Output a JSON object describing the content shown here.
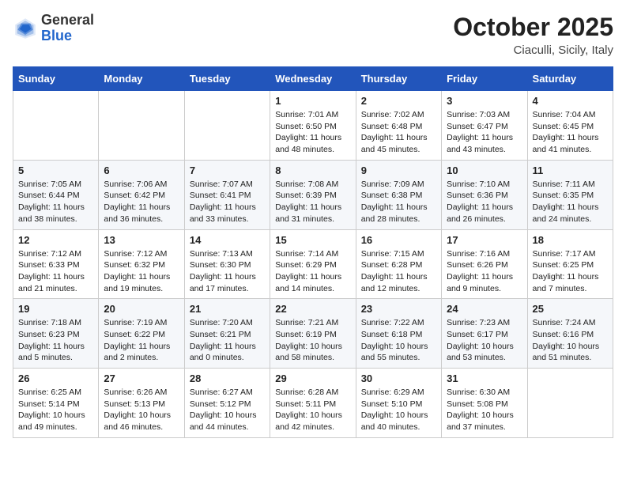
{
  "logo": {
    "general": "General",
    "blue": "Blue"
  },
  "header": {
    "month": "October 2025",
    "location": "Ciaculli, Sicily, Italy"
  },
  "weekdays": [
    "Sunday",
    "Monday",
    "Tuesday",
    "Wednesday",
    "Thursday",
    "Friday",
    "Saturday"
  ],
  "weeks": [
    [
      {
        "day": "",
        "info": ""
      },
      {
        "day": "",
        "info": ""
      },
      {
        "day": "",
        "info": ""
      },
      {
        "day": "1",
        "info": "Sunrise: 7:01 AM\nSunset: 6:50 PM\nDaylight: 11 hours\nand 48 minutes."
      },
      {
        "day": "2",
        "info": "Sunrise: 7:02 AM\nSunset: 6:48 PM\nDaylight: 11 hours\nand 45 minutes."
      },
      {
        "day": "3",
        "info": "Sunrise: 7:03 AM\nSunset: 6:47 PM\nDaylight: 11 hours\nand 43 minutes."
      },
      {
        "day": "4",
        "info": "Sunrise: 7:04 AM\nSunset: 6:45 PM\nDaylight: 11 hours\nand 41 minutes."
      }
    ],
    [
      {
        "day": "5",
        "info": "Sunrise: 7:05 AM\nSunset: 6:44 PM\nDaylight: 11 hours\nand 38 minutes."
      },
      {
        "day": "6",
        "info": "Sunrise: 7:06 AM\nSunset: 6:42 PM\nDaylight: 11 hours\nand 36 minutes."
      },
      {
        "day": "7",
        "info": "Sunrise: 7:07 AM\nSunset: 6:41 PM\nDaylight: 11 hours\nand 33 minutes."
      },
      {
        "day": "8",
        "info": "Sunrise: 7:08 AM\nSunset: 6:39 PM\nDaylight: 11 hours\nand 31 minutes."
      },
      {
        "day": "9",
        "info": "Sunrise: 7:09 AM\nSunset: 6:38 PM\nDaylight: 11 hours\nand 28 minutes."
      },
      {
        "day": "10",
        "info": "Sunrise: 7:10 AM\nSunset: 6:36 PM\nDaylight: 11 hours\nand 26 minutes."
      },
      {
        "day": "11",
        "info": "Sunrise: 7:11 AM\nSunset: 6:35 PM\nDaylight: 11 hours\nand 24 minutes."
      }
    ],
    [
      {
        "day": "12",
        "info": "Sunrise: 7:12 AM\nSunset: 6:33 PM\nDaylight: 11 hours\nand 21 minutes."
      },
      {
        "day": "13",
        "info": "Sunrise: 7:12 AM\nSunset: 6:32 PM\nDaylight: 11 hours\nand 19 minutes."
      },
      {
        "day": "14",
        "info": "Sunrise: 7:13 AM\nSunset: 6:30 PM\nDaylight: 11 hours\nand 17 minutes."
      },
      {
        "day": "15",
        "info": "Sunrise: 7:14 AM\nSunset: 6:29 PM\nDaylight: 11 hours\nand 14 minutes."
      },
      {
        "day": "16",
        "info": "Sunrise: 7:15 AM\nSunset: 6:28 PM\nDaylight: 11 hours\nand 12 minutes."
      },
      {
        "day": "17",
        "info": "Sunrise: 7:16 AM\nSunset: 6:26 PM\nDaylight: 11 hours\nand 9 minutes."
      },
      {
        "day": "18",
        "info": "Sunrise: 7:17 AM\nSunset: 6:25 PM\nDaylight: 11 hours\nand 7 minutes."
      }
    ],
    [
      {
        "day": "19",
        "info": "Sunrise: 7:18 AM\nSunset: 6:23 PM\nDaylight: 11 hours\nand 5 minutes."
      },
      {
        "day": "20",
        "info": "Sunrise: 7:19 AM\nSunset: 6:22 PM\nDaylight: 11 hours\nand 2 minutes."
      },
      {
        "day": "21",
        "info": "Sunrise: 7:20 AM\nSunset: 6:21 PM\nDaylight: 11 hours\nand 0 minutes."
      },
      {
        "day": "22",
        "info": "Sunrise: 7:21 AM\nSunset: 6:19 PM\nDaylight: 10 hours\nand 58 minutes."
      },
      {
        "day": "23",
        "info": "Sunrise: 7:22 AM\nSunset: 6:18 PM\nDaylight: 10 hours\nand 55 minutes."
      },
      {
        "day": "24",
        "info": "Sunrise: 7:23 AM\nSunset: 6:17 PM\nDaylight: 10 hours\nand 53 minutes."
      },
      {
        "day": "25",
        "info": "Sunrise: 7:24 AM\nSunset: 6:16 PM\nDaylight: 10 hours\nand 51 minutes."
      }
    ],
    [
      {
        "day": "26",
        "info": "Sunrise: 6:25 AM\nSunset: 5:14 PM\nDaylight: 10 hours\nand 49 minutes."
      },
      {
        "day": "27",
        "info": "Sunrise: 6:26 AM\nSunset: 5:13 PM\nDaylight: 10 hours\nand 46 minutes."
      },
      {
        "day": "28",
        "info": "Sunrise: 6:27 AM\nSunset: 5:12 PM\nDaylight: 10 hours\nand 44 minutes."
      },
      {
        "day": "29",
        "info": "Sunrise: 6:28 AM\nSunset: 5:11 PM\nDaylight: 10 hours\nand 42 minutes."
      },
      {
        "day": "30",
        "info": "Sunrise: 6:29 AM\nSunset: 5:10 PM\nDaylight: 10 hours\nand 40 minutes."
      },
      {
        "day": "31",
        "info": "Sunrise: 6:30 AM\nSunset: 5:08 PM\nDaylight: 10 hours\nand 37 minutes."
      },
      {
        "day": "",
        "info": ""
      }
    ]
  ]
}
